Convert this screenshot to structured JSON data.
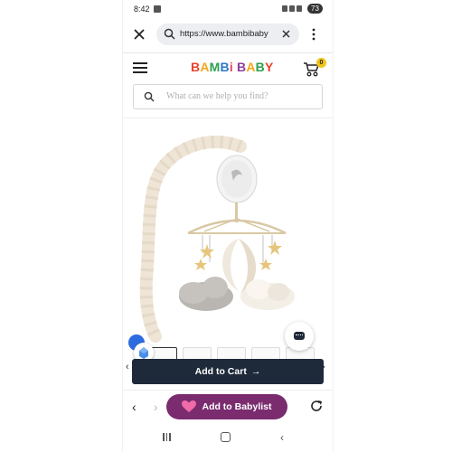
{
  "status": {
    "time": "8:42",
    "battery": "73"
  },
  "browser": {
    "url": "https://www.bambibaby"
  },
  "site": {
    "logo_letters": [
      {
        "ch": "B",
        "color": "#e8452c"
      },
      {
        "ch": "A",
        "color": "#f2a71b"
      },
      {
        "ch": "M",
        "color": "#2e9f4d"
      },
      {
        "ch": "B",
        "color": "#2a78c8"
      },
      {
        "ch": "i",
        "color": "#e5475e"
      },
      {
        "ch": " ",
        "color": "#000000"
      },
      {
        "ch": "B",
        "color": "#8f3e98"
      },
      {
        "ch": "A",
        "color": "#f2a71b"
      },
      {
        "ch": "B",
        "color": "#2e9f4d"
      },
      {
        "ch": "Y",
        "color": "#e8452c"
      }
    ],
    "cart_count": "0",
    "search_placeholder": "What can we help you find?"
  },
  "product": {
    "thumbnail_count": 5,
    "add_to_cart_label": "Add to Cart",
    "add_to_cart_arrow": "→"
  },
  "babylist": {
    "label": "Add to Babylist"
  },
  "colors": {
    "primary_dark": "#1e2a3a",
    "babylist": "#7a2c6f",
    "cart_badge": "#f0c419"
  }
}
